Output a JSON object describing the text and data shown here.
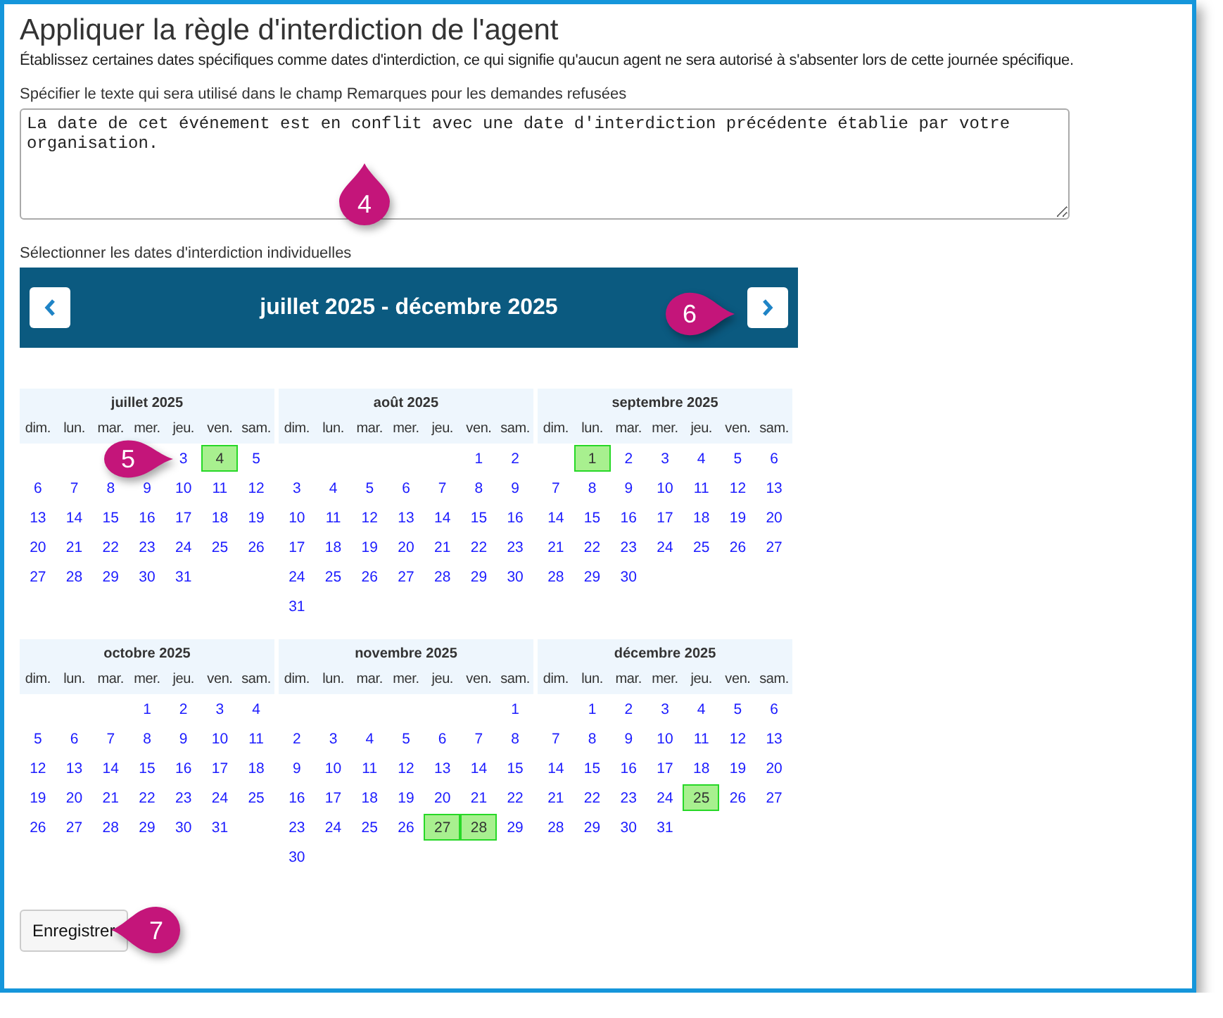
{
  "page": {
    "title": "Appliquer la règle d'interdiction de l'agent",
    "description": "Établissez certaines dates spécifiques comme dates d'interdiction, ce qui signifie qu'aucun agent ne sera autorisé à s'absenter lors de cette journée spécifique."
  },
  "remarks": {
    "label": "Spécifier le texte qui sera utilisé dans le champ Remarques pour les demandes refusées",
    "value": "La date de cet événement est en conflit avec une date d'interdiction précédente établie par votre organisation."
  },
  "calendar": {
    "label": "Sélectionner les dates d'interdiction individuelles",
    "range_title": "juillet 2025 - décembre 2025",
    "months": [
      {
        "title": "juillet 2025",
        "weekdays": [
          "dim.",
          "lun.",
          "mar.",
          "mer.",
          "jeu.",
          "ven.",
          "sam."
        ],
        "weeks": [
          [
            {
              "kind": "blank"
            },
            {
              "kind": "blank"
            },
            {
              "kind": "blank"
            },
            {
              "kind": "blank"
            },
            {
              "kind": "day",
              "day": "3",
              "selected": false
            },
            {
              "kind": "day",
              "day": "4",
              "selected": true
            },
            {
              "kind": "day",
              "day": "5",
              "selected": false
            }
          ],
          [
            {
              "kind": "day",
              "day": "6",
              "selected": false
            },
            {
              "kind": "day",
              "day": "7",
              "selected": false
            },
            {
              "kind": "day",
              "day": "8",
              "selected": false
            },
            {
              "kind": "day",
              "day": "9",
              "selected": false
            },
            {
              "kind": "day",
              "day": "10",
              "selected": false
            },
            {
              "kind": "day",
              "day": "11",
              "selected": false
            },
            {
              "kind": "day",
              "day": "12",
              "selected": false
            }
          ],
          [
            {
              "kind": "day",
              "day": "13",
              "selected": false
            },
            {
              "kind": "day",
              "day": "14",
              "selected": false
            },
            {
              "kind": "day",
              "day": "15",
              "selected": false
            },
            {
              "kind": "day",
              "day": "16",
              "selected": false
            },
            {
              "kind": "day",
              "day": "17",
              "selected": false
            },
            {
              "kind": "day",
              "day": "18",
              "selected": false
            },
            {
              "kind": "day",
              "day": "19",
              "selected": false
            }
          ],
          [
            {
              "kind": "day",
              "day": "20",
              "selected": false
            },
            {
              "kind": "day",
              "day": "21",
              "selected": false
            },
            {
              "kind": "day",
              "day": "22",
              "selected": false
            },
            {
              "kind": "day",
              "day": "23",
              "selected": false
            },
            {
              "kind": "day",
              "day": "24",
              "selected": false
            },
            {
              "kind": "day",
              "day": "25",
              "selected": false
            },
            {
              "kind": "day",
              "day": "26",
              "selected": false
            }
          ],
          [
            {
              "kind": "day",
              "day": "27",
              "selected": false
            },
            {
              "kind": "day",
              "day": "28",
              "selected": false
            },
            {
              "kind": "day",
              "day": "29",
              "selected": false
            },
            {
              "kind": "day",
              "day": "30",
              "selected": false
            },
            {
              "kind": "day",
              "day": "31",
              "selected": false
            }
          ]
        ]
      },
      {
        "title": "août 2025",
        "weekdays": [
          "dim.",
          "lun.",
          "mar.",
          "mer.",
          "jeu.",
          "ven.",
          "sam."
        ],
        "weeks": [
          [
            {
              "kind": "blank"
            },
            {
              "kind": "blank"
            },
            {
              "kind": "blank"
            },
            {
              "kind": "blank"
            },
            {
              "kind": "blank"
            },
            {
              "kind": "day",
              "day": "1",
              "selected": false
            },
            {
              "kind": "day",
              "day": "2",
              "selected": false
            }
          ],
          [
            {
              "kind": "day",
              "day": "3",
              "selected": false
            },
            {
              "kind": "day",
              "day": "4",
              "selected": false
            },
            {
              "kind": "day",
              "day": "5",
              "selected": false
            },
            {
              "kind": "day",
              "day": "6",
              "selected": false
            },
            {
              "kind": "day",
              "day": "7",
              "selected": false
            },
            {
              "kind": "day",
              "day": "8",
              "selected": false
            },
            {
              "kind": "day",
              "day": "9",
              "selected": false
            }
          ],
          [
            {
              "kind": "day",
              "day": "10",
              "selected": false
            },
            {
              "kind": "day",
              "day": "11",
              "selected": false
            },
            {
              "kind": "day",
              "day": "12",
              "selected": false
            },
            {
              "kind": "day",
              "day": "13",
              "selected": false
            },
            {
              "kind": "day",
              "day": "14",
              "selected": false
            },
            {
              "kind": "day",
              "day": "15",
              "selected": false
            },
            {
              "kind": "day",
              "day": "16",
              "selected": false
            }
          ],
          [
            {
              "kind": "day",
              "day": "17",
              "selected": false
            },
            {
              "kind": "day",
              "day": "18",
              "selected": false
            },
            {
              "kind": "day",
              "day": "19",
              "selected": false
            },
            {
              "kind": "day",
              "day": "20",
              "selected": false
            },
            {
              "kind": "day",
              "day": "21",
              "selected": false
            },
            {
              "kind": "day",
              "day": "22",
              "selected": false
            },
            {
              "kind": "day",
              "day": "23",
              "selected": false
            }
          ],
          [
            {
              "kind": "day",
              "day": "24",
              "selected": false
            },
            {
              "kind": "day",
              "day": "25",
              "selected": false
            },
            {
              "kind": "day",
              "day": "26",
              "selected": false
            },
            {
              "kind": "day",
              "day": "27",
              "selected": false
            },
            {
              "kind": "day",
              "day": "28",
              "selected": false
            },
            {
              "kind": "day",
              "day": "29",
              "selected": false
            },
            {
              "kind": "day",
              "day": "30",
              "selected": false
            }
          ],
          [
            {
              "kind": "day",
              "day": "31",
              "selected": false
            }
          ]
        ]
      },
      {
        "title": "septembre 2025",
        "weekdays": [
          "dim.",
          "lun.",
          "mar.",
          "mer.",
          "jeu.",
          "ven.",
          "sam."
        ],
        "weeks": [
          [
            {
              "kind": "blank"
            },
            {
              "kind": "day",
              "day": "1",
              "selected": true
            },
            {
              "kind": "day",
              "day": "2",
              "selected": false
            },
            {
              "kind": "day",
              "day": "3",
              "selected": false
            },
            {
              "kind": "day",
              "day": "4",
              "selected": false
            },
            {
              "kind": "day",
              "day": "5",
              "selected": false
            },
            {
              "kind": "day",
              "day": "6",
              "selected": false
            }
          ],
          [
            {
              "kind": "day",
              "day": "7",
              "selected": false
            },
            {
              "kind": "day",
              "day": "8",
              "selected": false
            },
            {
              "kind": "day",
              "day": "9",
              "selected": false
            },
            {
              "kind": "day",
              "day": "10",
              "selected": false
            },
            {
              "kind": "day",
              "day": "11",
              "selected": false
            },
            {
              "kind": "day",
              "day": "12",
              "selected": false
            },
            {
              "kind": "day",
              "day": "13",
              "selected": false
            }
          ],
          [
            {
              "kind": "day",
              "day": "14",
              "selected": false
            },
            {
              "kind": "day",
              "day": "15",
              "selected": false
            },
            {
              "kind": "day",
              "day": "16",
              "selected": false
            },
            {
              "kind": "day",
              "day": "17",
              "selected": false
            },
            {
              "kind": "day",
              "day": "18",
              "selected": false
            },
            {
              "kind": "day",
              "day": "19",
              "selected": false
            },
            {
              "kind": "day",
              "day": "20",
              "selected": false
            }
          ],
          [
            {
              "kind": "day",
              "day": "21",
              "selected": false
            },
            {
              "kind": "day",
              "day": "22",
              "selected": false
            },
            {
              "kind": "day",
              "day": "23",
              "selected": false
            },
            {
              "kind": "day",
              "day": "24",
              "selected": false
            },
            {
              "kind": "day",
              "day": "25",
              "selected": false
            },
            {
              "kind": "day",
              "day": "26",
              "selected": false
            },
            {
              "kind": "day",
              "day": "27",
              "selected": false
            }
          ],
          [
            {
              "kind": "day",
              "day": "28",
              "selected": false
            },
            {
              "kind": "day",
              "day": "29",
              "selected": false
            },
            {
              "kind": "day",
              "day": "30",
              "selected": false
            }
          ]
        ]
      },
      {
        "title": "octobre 2025",
        "weekdays": [
          "dim.",
          "lun.",
          "mar.",
          "mer.",
          "jeu.",
          "ven.",
          "sam."
        ],
        "weeks": [
          [
            {
              "kind": "blank"
            },
            {
              "kind": "blank"
            },
            {
              "kind": "blank"
            },
            {
              "kind": "day",
              "day": "1",
              "selected": false
            },
            {
              "kind": "day",
              "day": "2",
              "selected": false
            },
            {
              "kind": "day",
              "day": "3",
              "selected": false
            },
            {
              "kind": "day",
              "day": "4",
              "selected": false
            }
          ],
          [
            {
              "kind": "day",
              "day": "5",
              "selected": false
            },
            {
              "kind": "day",
              "day": "6",
              "selected": false
            },
            {
              "kind": "day",
              "day": "7",
              "selected": false
            },
            {
              "kind": "day",
              "day": "8",
              "selected": false
            },
            {
              "kind": "day",
              "day": "9",
              "selected": false
            },
            {
              "kind": "day",
              "day": "10",
              "selected": false
            },
            {
              "kind": "day",
              "day": "11",
              "selected": false
            }
          ],
          [
            {
              "kind": "day",
              "day": "12",
              "selected": false
            },
            {
              "kind": "day",
              "day": "13",
              "selected": false
            },
            {
              "kind": "day",
              "day": "14",
              "selected": false
            },
            {
              "kind": "day",
              "day": "15",
              "selected": false
            },
            {
              "kind": "day",
              "day": "16",
              "selected": false
            },
            {
              "kind": "day",
              "day": "17",
              "selected": false
            },
            {
              "kind": "day",
              "day": "18",
              "selected": false
            }
          ],
          [
            {
              "kind": "day",
              "day": "19",
              "selected": false
            },
            {
              "kind": "day",
              "day": "20",
              "selected": false
            },
            {
              "kind": "day",
              "day": "21",
              "selected": false
            },
            {
              "kind": "day",
              "day": "22",
              "selected": false
            },
            {
              "kind": "day",
              "day": "23",
              "selected": false
            },
            {
              "kind": "day",
              "day": "24",
              "selected": false
            },
            {
              "kind": "day",
              "day": "25",
              "selected": false
            }
          ],
          [
            {
              "kind": "day",
              "day": "26",
              "selected": false
            },
            {
              "kind": "day",
              "day": "27",
              "selected": false
            },
            {
              "kind": "day",
              "day": "28",
              "selected": false
            },
            {
              "kind": "day",
              "day": "29",
              "selected": false
            },
            {
              "kind": "day",
              "day": "30",
              "selected": false
            },
            {
              "kind": "day",
              "day": "31",
              "selected": false
            }
          ]
        ]
      },
      {
        "title": "novembre 2025",
        "weekdays": [
          "dim.",
          "lun.",
          "mar.",
          "mer.",
          "jeu.",
          "ven.",
          "sam."
        ],
        "weeks": [
          [
            {
              "kind": "blank"
            },
            {
              "kind": "blank"
            },
            {
              "kind": "blank"
            },
            {
              "kind": "blank"
            },
            {
              "kind": "blank"
            },
            {
              "kind": "blank"
            },
            {
              "kind": "day",
              "day": "1",
              "selected": false
            }
          ],
          [
            {
              "kind": "day",
              "day": "2",
              "selected": false
            },
            {
              "kind": "day",
              "day": "3",
              "selected": false
            },
            {
              "kind": "day",
              "day": "4",
              "selected": false
            },
            {
              "kind": "day",
              "day": "5",
              "selected": false
            },
            {
              "kind": "day",
              "day": "6",
              "selected": false
            },
            {
              "kind": "day",
              "day": "7",
              "selected": false
            },
            {
              "kind": "day",
              "day": "8",
              "selected": false
            }
          ],
          [
            {
              "kind": "day",
              "day": "9",
              "selected": false
            },
            {
              "kind": "day",
              "day": "10",
              "selected": false
            },
            {
              "kind": "day",
              "day": "11",
              "selected": false
            },
            {
              "kind": "day",
              "day": "12",
              "selected": false
            },
            {
              "kind": "day",
              "day": "13",
              "selected": false
            },
            {
              "kind": "day",
              "day": "14",
              "selected": false
            },
            {
              "kind": "day",
              "day": "15",
              "selected": false
            }
          ],
          [
            {
              "kind": "day",
              "day": "16",
              "selected": false
            },
            {
              "kind": "day",
              "day": "17",
              "selected": false
            },
            {
              "kind": "day",
              "day": "18",
              "selected": false
            },
            {
              "kind": "day",
              "day": "19",
              "selected": false
            },
            {
              "kind": "day",
              "day": "20",
              "selected": false
            },
            {
              "kind": "day",
              "day": "21",
              "selected": false
            },
            {
              "kind": "day",
              "day": "22",
              "selected": false
            }
          ],
          [
            {
              "kind": "day",
              "day": "23",
              "selected": false
            },
            {
              "kind": "day",
              "day": "24",
              "selected": false
            },
            {
              "kind": "day",
              "day": "25",
              "selected": false
            },
            {
              "kind": "day",
              "day": "26",
              "selected": false
            },
            {
              "kind": "day",
              "day": "27",
              "selected": true
            },
            {
              "kind": "day",
              "day": "28",
              "selected": true
            },
            {
              "kind": "day",
              "day": "29",
              "selected": false
            }
          ],
          [
            {
              "kind": "day",
              "day": "30",
              "selected": false
            }
          ]
        ]
      },
      {
        "title": "décembre 2025",
        "weekdays": [
          "dim.",
          "lun.",
          "mar.",
          "mer.",
          "jeu.",
          "ven.",
          "sam."
        ],
        "weeks": [
          [
            {
              "kind": "blank"
            },
            {
              "kind": "day",
              "day": "1",
              "selected": false
            },
            {
              "kind": "day",
              "day": "2",
              "selected": false
            },
            {
              "kind": "day",
              "day": "3",
              "selected": false
            },
            {
              "kind": "day",
              "day": "4",
              "selected": false
            },
            {
              "kind": "day",
              "day": "5",
              "selected": false
            },
            {
              "kind": "day",
              "day": "6",
              "selected": false
            }
          ],
          [
            {
              "kind": "day",
              "day": "7",
              "selected": false
            },
            {
              "kind": "day",
              "day": "8",
              "selected": false
            },
            {
              "kind": "day",
              "day": "9",
              "selected": false
            },
            {
              "kind": "day",
              "day": "10",
              "selected": false
            },
            {
              "kind": "day",
              "day": "11",
              "selected": false
            },
            {
              "kind": "day",
              "day": "12",
              "selected": false
            },
            {
              "kind": "day",
              "day": "13",
              "selected": false
            }
          ],
          [
            {
              "kind": "day",
              "day": "14",
              "selected": false
            },
            {
              "kind": "day",
              "day": "15",
              "selected": false
            },
            {
              "kind": "day",
              "day": "16",
              "selected": false
            },
            {
              "kind": "day",
              "day": "17",
              "selected": false
            },
            {
              "kind": "day",
              "day": "18",
              "selected": false
            },
            {
              "kind": "day",
              "day": "19",
              "selected": false
            },
            {
              "kind": "day",
              "day": "20",
              "selected": false
            }
          ],
          [
            {
              "kind": "day",
              "day": "21",
              "selected": false
            },
            {
              "kind": "day",
              "day": "22",
              "selected": false
            },
            {
              "kind": "day",
              "day": "23",
              "selected": false
            },
            {
              "kind": "day",
              "day": "24",
              "selected": false
            },
            {
              "kind": "day",
              "day": "25",
              "selected": true
            },
            {
              "kind": "day",
              "day": "26",
              "selected": false
            },
            {
              "kind": "day",
              "day": "27",
              "selected": false
            }
          ],
          [
            {
              "kind": "day",
              "day": "28",
              "selected": false
            },
            {
              "kind": "day",
              "day": "29",
              "selected": false
            },
            {
              "kind": "day",
              "day": "30",
              "selected": false
            },
            {
              "kind": "day",
              "day": "31",
              "selected": false
            }
          ]
        ]
      }
    ]
  },
  "save_button": {
    "label": "Enregistrer"
  },
  "callouts": [
    {
      "label": "4",
      "kind": "up"
    },
    {
      "label": "5",
      "kind": "right"
    },
    {
      "label": "6",
      "kind": "right"
    },
    {
      "label": "7",
      "kind": "left"
    }
  ]
}
